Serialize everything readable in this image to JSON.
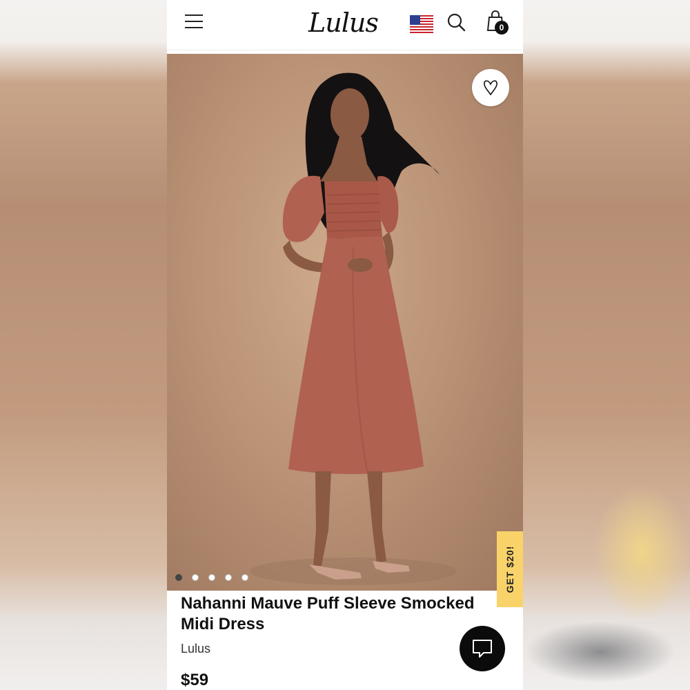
{
  "header": {
    "logo": "Lulus",
    "cart_count": "0",
    "icons": [
      "menu-icon",
      "us-flag-icon",
      "search-icon",
      "shopping-bag-icon"
    ]
  },
  "gallery": {
    "image_description": "model wearing mauve puff sleeve smocked midi dress",
    "slide_count": 5,
    "active_slide": 1
  },
  "promo": {
    "label": "GET $20!"
  },
  "product": {
    "title": "Nahanni Mauve Puff Sleeve Smocked Midi Dress",
    "brand": "Lulus",
    "price": "$59"
  },
  "colors": {
    "promo_bg": "#f9d36a",
    "dress": "#b0614f",
    "backdrop": "#b8977f"
  }
}
